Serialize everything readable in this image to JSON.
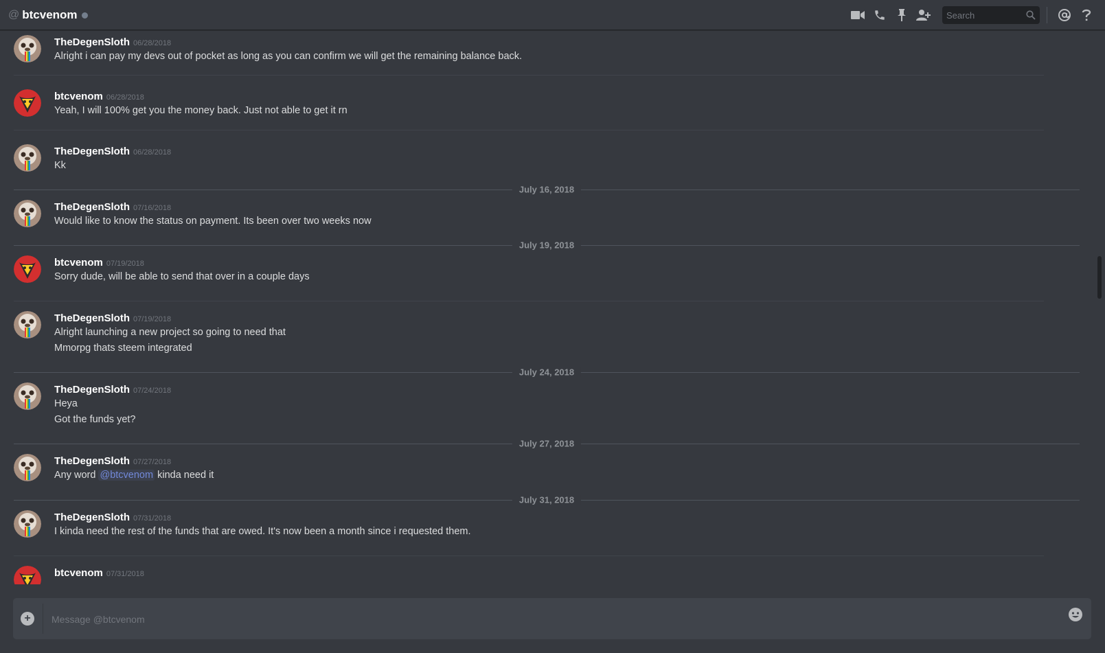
{
  "header": {
    "at_symbol": "@",
    "channel_name": "btcvenom",
    "search_placeholder": "Search"
  },
  "icons": {
    "video": "video-camera-icon",
    "call": "phone-icon",
    "pin": "pin-icon",
    "add_friend": "add-user-icon",
    "search": "search-icon",
    "mentions": "at-icon",
    "help": "help-icon"
  },
  "colors": {
    "background": "#36393f",
    "mention": "#7289da",
    "timestamp": "#72767d",
    "divider_text": "#8e9297"
  },
  "messages": [
    {
      "author": "TheDegenSloth",
      "timestamp": "06/28/2018",
      "lines": [
        "Alright i can pay my devs out of pocket as long as you can confirm we will get the remaining balance back."
      ]
    },
    {
      "author": "btcvenom",
      "timestamp": "06/28/2018",
      "lines": [
        "Yeah, I will 100% get you the money back. Just not able to get it rn"
      ]
    },
    {
      "author": "TheDegenSloth",
      "timestamp": "06/28/2018",
      "lines": [
        "Kk"
      ]
    },
    {
      "author": "TheDegenSloth",
      "timestamp": "07/16/2018",
      "lines": [
        "Would like to know the status on payment. Its been over two weeks now"
      ]
    },
    {
      "author": "btcvenom",
      "timestamp": "07/19/2018",
      "lines": [
        "Sorry dude, will be able to send that over in a couple days"
      ]
    },
    {
      "author": "TheDegenSloth",
      "timestamp": "07/19/2018",
      "lines": [
        "Alright launching a new project so going to need that",
        "Mmorpg thats steem integrated"
      ]
    },
    {
      "author": "TheDegenSloth",
      "timestamp": "07/24/2018",
      "lines": [
        "Heya",
        "Got the funds yet?"
      ]
    },
    {
      "author": "TheDegenSloth",
      "timestamp": "07/27/2018",
      "lines_parts": {
        "before": "Any word ",
        "mention": "@btcvenom",
        "after": " kinda need it"
      }
    },
    {
      "author": "TheDegenSloth",
      "timestamp": "07/31/2018",
      "lines": [
        "I kinda need the rest of the funds that are owed. It's now been a month since i requested them."
      ]
    },
    {
      "author": "btcvenom",
      "timestamp": "07/31/2018",
      "lines": []
    }
  ],
  "date_dividers": [
    "July 16, 2018",
    "July 19, 2018",
    "July 24, 2018",
    "July 27, 2018",
    "July 31, 2018"
  ],
  "composer": {
    "placeholder": "Message @btcvenom"
  }
}
